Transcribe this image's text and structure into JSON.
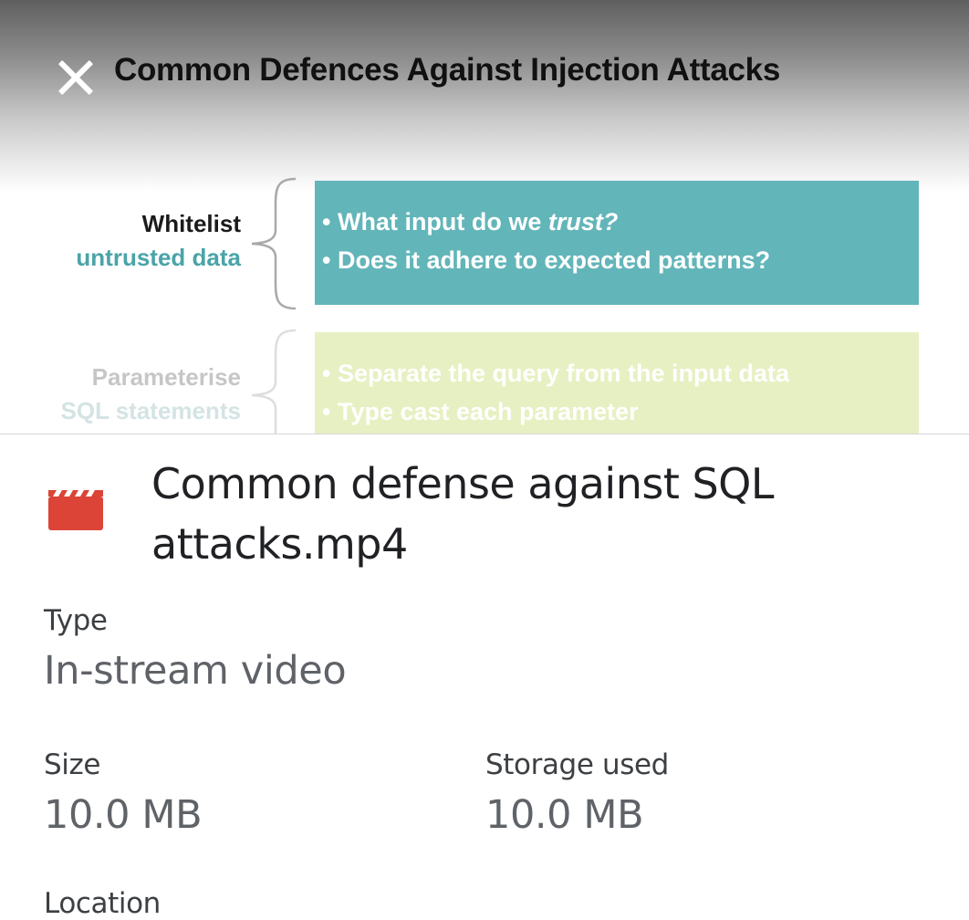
{
  "preview": {
    "title": "Common Defences Against Injection Attacks",
    "rows": [
      {
        "label_1": "Whitelist",
        "label_2": "untrusted data",
        "bullets": [
          "• What input do we ",
          "trust?",
          "• Does it adhere to expected patterns?"
        ]
      },
      {
        "label_1": "Parameterise",
        "label_2": "SQL statements",
        "bullets": [
          "• Separate the query from the input data",
          "• Type cast each parameter"
        ]
      }
    ],
    "colors": {
      "box_1": "#62b5b9",
      "box_2": "#e7f0c2",
      "accent_text": "#4aa4a8"
    }
  },
  "file": {
    "icon": "video-file-icon",
    "icon_color": "#db4437",
    "name": "Common defense against SQL attacks.mp4"
  },
  "details": {
    "type_label": "Type",
    "type_value": "In-stream video",
    "size_label": "Size",
    "size_value": "10.0 MB",
    "storage_label": "Storage used",
    "storage_value": "10.0 MB",
    "location_label": "Location"
  }
}
